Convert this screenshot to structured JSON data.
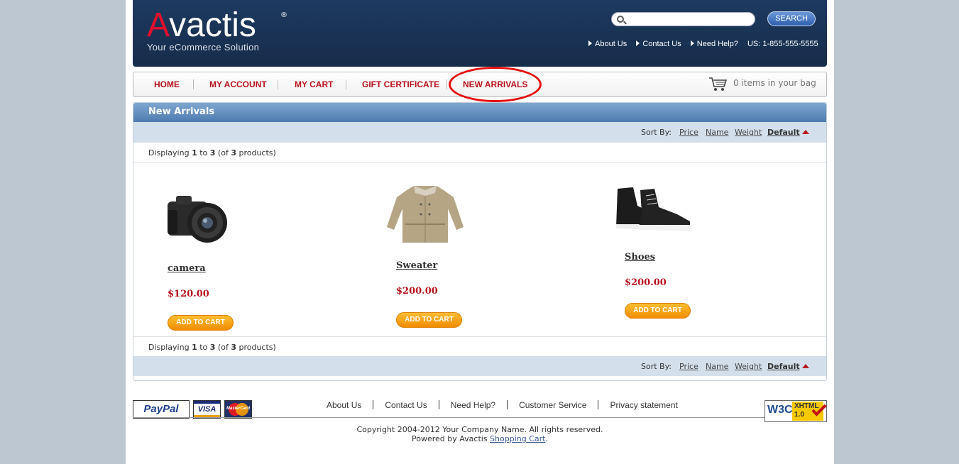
{
  "header": {
    "logo_name": "vactis",
    "logo_initial": "A",
    "logo_reg": "®",
    "logo_tagline": "Your eCommerce Solution",
    "search_placeholder": "",
    "search_button": "SEARCH",
    "top_links": [
      "About Us",
      "Contact Us",
      "Need Help?"
    ],
    "phone": "US: 1-855-555-5555"
  },
  "nav": {
    "items": [
      "HOME",
      "MY ACCOUNT",
      "MY CART",
      "GIFT CERTIFICATE",
      "NEW ARRIVALS"
    ],
    "bag_text": "0 items in your bag"
  },
  "panel": {
    "title": "New Arrivals",
    "sort_label": "Sort By:",
    "sort_options": [
      "Price",
      "Name",
      "Weight"
    ],
    "sort_default": "Default",
    "displaying": {
      "prefix": "Displaying",
      "from": "1",
      "to_word": "to",
      "to": "3",
      "of_prefix": "(of",
      "total": "3",
      "suffix": "products)"
    }
  },
  "products": [
    {
      "name": "camera",
      "price": "$120.00",
      "button": "ADD TO CART"
    },
    {
      "name": "Sweater",
      "price": "$200.00",
      "button": "ADD TO CART"
    },
    {
      "name": "Shoes",
      "price": "$200.00",
      "button": "ADD TO CART"
    }
  ],
  "footer": {
    "links": [
      "About Us",
      "Contact Us",
      "Need Help?",
      "Customer Service",
      "Privacy statement"
    ],
    "copyright": "Copyright 2004-2012 Your Company Name. All rights reserved.",
    "powered_prefix": "Powered by Avactis",
    "powered_link": "Shopping Cart",
    "powered_suffix": ".",
    "paypal": "PayPal",
    "visa": "VISA",
    "mastercard": "MasterCard",
    "w3c": "W3C",
    "xhtml": "XHTML 1.0"
  },
  "colors": {
    "header_bg": "#1c3457",
    "accent_red": "#b8121d",
    "sort_bar": "#d3e0ec",
    "add_to_cart": "#f59a00"
  }
}
